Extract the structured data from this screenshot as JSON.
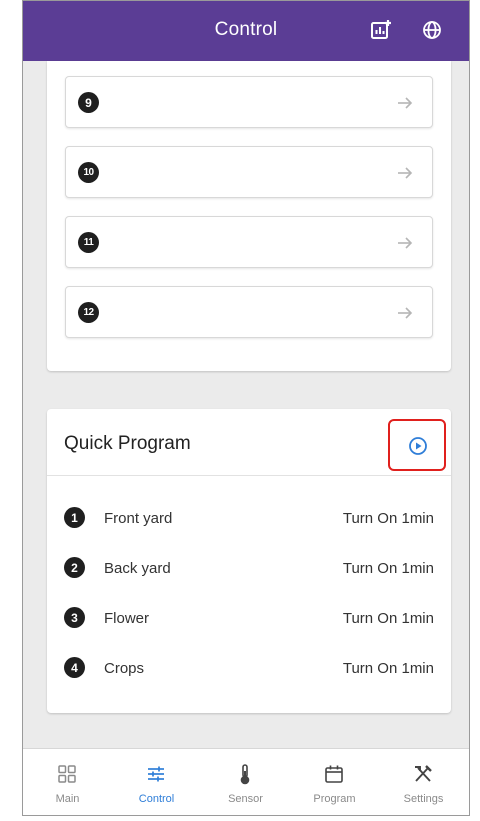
{
  "header": {
    "title": "Control",
    "chart_icon": "chart-add-icon",
    "globe_icon": "globe-icon",
    "background_color": "#5b3d95"
  },
  "zones": [
    {
      "number": "9"
    },
    {
      "number": "10"
    },
    {
      "number": "11"
    },
    {
      "number": "12"
    }
  ],
  "quick_program": {
    "title": "Quick Program",
    "run_icon": "play-circle-icon",
    "items": [
      {
        "number": "1",
        "name": "Front yard",
        "action": "Turn On 1min"
      },
      {
        "number": "2",
        "name": "Back yard",
        "action": "Turn On 1min"
      },
      {
        "number": "3",
        "name": "Flower",
        "action": "Turn On 1min"
      },
      {
        "number": "4",
        "name": "Crops",
        "action": "Turn On 1min"
      }
    ]
  },
  "bottom_nav": {
    "active": "Control",
    "active_color": "#2f7ed8",
    "items": [
      {
        "label": "Main",
        "icon": "grid-icon"
      },
      {
        "label": "Control",
        "icon": "sliders-icon"
      },
      {
        "label": "Sensor",
        "icon": "thermometer-icon"
      },
      {
        "label": "Program",
        "icon": "calendar-icon"
      },
      {
        "label": "Settings",
        "icon": "tools-icon"
      }
    ]
  }
}
